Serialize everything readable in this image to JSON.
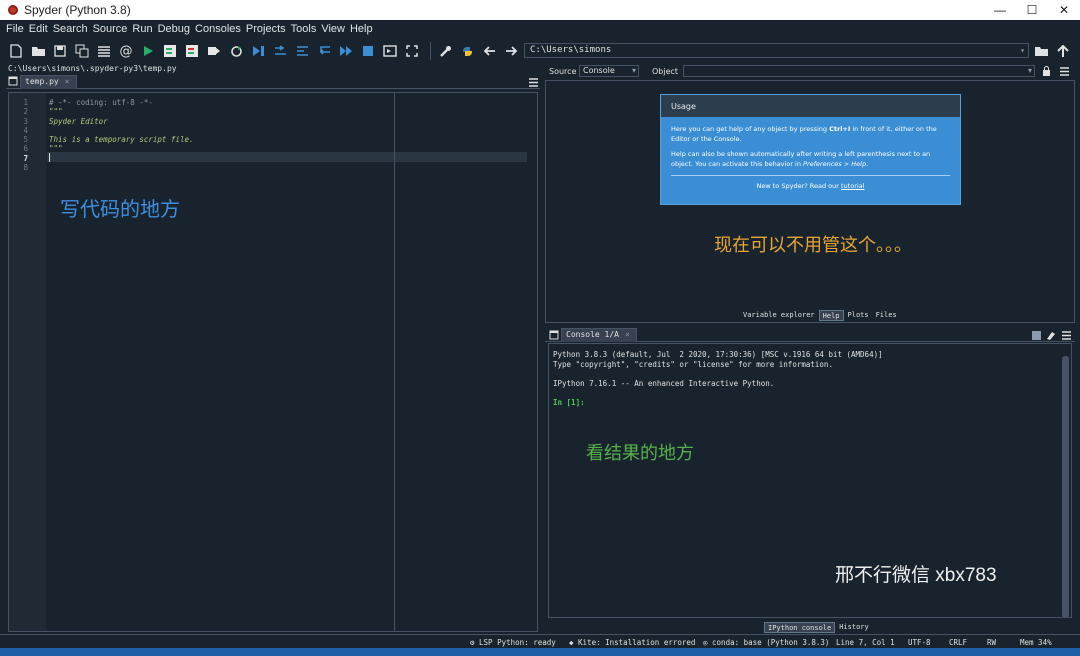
{
  "window": {
    "title": "Spyder (Python 3.8)",
    "minimize": "—",
    "maximize": "☐",
    "close": "✕"
  },
  "menu": [
    "File",
    "Edit",
    "Search",
    "Source",
    "Run",
    "Debug",
    "Consoles",
    "Projects",
    "Tools",
    "View",
    "Help"
  ],
  "toolbar": {
    "working_dir": "C:\\Users\\simons"
  },
  "editor": {
    "file_path": "C:\\Users\\simons\\.spyder-py3\\temp.py",
    "tab": "temp.py",
    "tab_close": "×",
    "current_line": 7,
    "line_numbers": [
      "1",
      "2",
      "3",
      "4",
      "5",
      "6",
      "7",
      "8"
    ],
    "lines": [
      {
        "text": "# -*- coding: utf-8 -*-",
        "kind": "comment"
      },
      {
        "text": "\"\"\"",
        "kind": "string"
      },
      {
        "text": "",
        "kind": "string"
      },
      {
        "text": "Spyder Editor",
        "kind": "string"
      },
      {
        "text": "",
        "kind": "string"
      },
      {
        "text": "This is a temporary script file.",
        "kind": "string"
      },
      {
        "text": "\"\"\"",
        "kind": "string"
      },
      {
        "text": "",
        "kind": "plain"
      }
    ],
    "annotation": "写代码的地方"
  },
  "help": {
    "source_label": "Source",
    "source_value": "Console",
    "object_label": "Object",
    "usage_title": "Usage",
    "usage_p1_a": "Here you can get help of any object by pressing ",
    "usage_p1_key": "Ctrl+I",
    "usage_p1_b": " in front of it, either on the Editor or the Console.",
    "usage_p2_a": "Help can also be shown automatically after writing a left parenthesis next to an object. You can activate this behavior in ",
    "usage_p2_path": "Preferences > Help",
    "usage_p2_b": ".",
    "usage_foot_a": "New to Spyder? Read our ",
    "usage_foot_link": "tutorial",
    "annotation": "现在可以不用管这个。。。",
    "tabs": [
      "Variable explorer",
      "Help",
      "Plots",
      "Files"
    ],
    "active_tab": "Help"
  },
  "console": {
    "tab": "Console 1/A",
    "tab_close": "×",
    "lines": [
      "Python 3.8.3 (default, Jul  2 2020, 17:30:36) [MSC v.1916 64 bit (AMD64)]",
      "Type \"copyright\", \"credits\" or \"license\" for more information.",
      "",
      "IPython 7.16.1 -- An enhanced Interactive Python.",
      ""
    ],
    "prompt": "In [1]:",
    "annotation": "看结果的地方",
    "bottom_tabs": [
      "IPython console",
      "History"
    ],
    "active_bottom_tab": "IPython console"
  },
  "watermark": "邢不行微信 xbx783",
  "status": {
    "lsp": "LSP Python: ready",
    "kite": "Kite: Installation errored",
    "conda": "conda: base (Python 3.8.3)",
    "position": "Line 7, Col 1",
    "encoding": "UTF-8",
    "eol": "CRLF",
    "perm": "RW",
    "memory": "Mem 34%"
  },
  "colors": {
    "bg": "#19232d",
    "panel_border": "#455364",
    "usage_blue": "#3b8ed4",
    "run_green": "#27ae60",
    "annot_blue": "#3d8fe0",
    "annot_orange": "#e8a534",
    "annot_green": "#55b04a"
  }
}
